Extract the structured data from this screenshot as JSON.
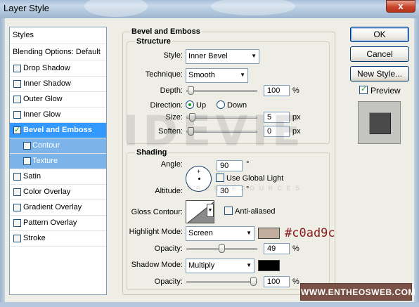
{
  "window": {
    "title": "Layer Style",
    "close_glyph": "x"
  },
  "styles_panel": {
    "header": "Styles",
    "blending": "Blending Options: Default",
    "items": [
      {
        "label": "Drop Shadow",
        "checked": false
      },
      {
        "label": "Inner Shadow",
        "checked": false
      },
      {
        "label": "Outer Glow",
        "checked": false
      },
      {
        "label": "Inner Glow",
        "checked": false
      },
      {
        "label": "Bevel and Emboss",
        "checked": true,
        "selected": true
      },
      {
        "label": "Contour",
        "checked": false,
        "sub": true
      },
      {
        "label": "Texture",
        "checked": false,
        "sub": true
      },
      {
        "label": "Satin",
        "checked": false
      },
      {
        "label": "Color Overlay",
        "checked": false
      },
      {
        "label": "Gradient Overlay",
        "checked": false
      },
      {
        "label": "Pattern Overlay",
        "checked": false
      },
      {
        "label": "Stroke",
        "checked": false
      }
    ]
  },
  "bevel": {
    "section_title": "Bevel and Emboss",
    "structure": {
      "title": "Structure",
      "style_label": "Style:",
      "style_value": "Inner Bevel",
      "technique_label": "Technique:",
      "technique_value": "Smooth",
      "depth_label": "Depth:",
      "depth_value": "100",
      "depth_unit": "%",
      "depth_level": 0.0,
      "direction_label": "Direction:",
      "direction_up": "Up",
      "direction_down": "Down",
      "direction_selected": "Up",
      "size_label": "Size:",
      "size_value": "5",
      "size_unit": "px",
      "size_level": 0.02,
      "soften_label": "Soften:",
      "soften_value": "0",
      "soften_unit": "px",
      "soften_level": 0.0
    },
    "shading": {
      "title": "Shading",
      "angle_label": "Angle:",
      "angle_value": "90",
      "angle_unit": "°",
      "global_light_label": "Use Global Light",
      "global_light_checked": false,
      "altitude_label": "Altitude:",
      "altitude_value": "30",
      "altitude_unit": "°",
      "gloss_label": "Gloss Contour:",
      "anti_aliased_label": "Anti-aliased",
      "anti_aliased_checked": false,
      "highlight_mode_label": "Highlight Mode:",
      "highlight_mode_value": "Screen",
      "highlight_color": "#c0ad9c",
      "highlight_opacity_label": "Opacity:",
      "highlight_opacity_value": "49",
      "highlight_opacity_unit": "%",
      "highlight_opacity_level": 0.49,
      "shadow_mode_label": "Shadow Mode:",
      "shadow_mode_value": "Multiply",
      "shadow_color": "#000000",
      "shadow_opacity_label": "Opacity:",
      "shadow_opacity_value": "100",
      "shadow_opacity_unit": "%",
      "shadow_opacity_level": 1.0
    }
  },
  "buttons": {
    "ok": "OK",
    "cancel": "Cancel",
    "new_style": "New Style...",
    "preview_label": "Preview",
    "preview_checked": true
  },
  "overlays": {
    "watermark": "IDEVIE",
    "watermark_sub": "F R E E   R E S O U R C E S",
    "color_annotation": "#c0ad9c",
    "site_banner": "WWW.ENTHEOSWEB.COM"
  }
}
